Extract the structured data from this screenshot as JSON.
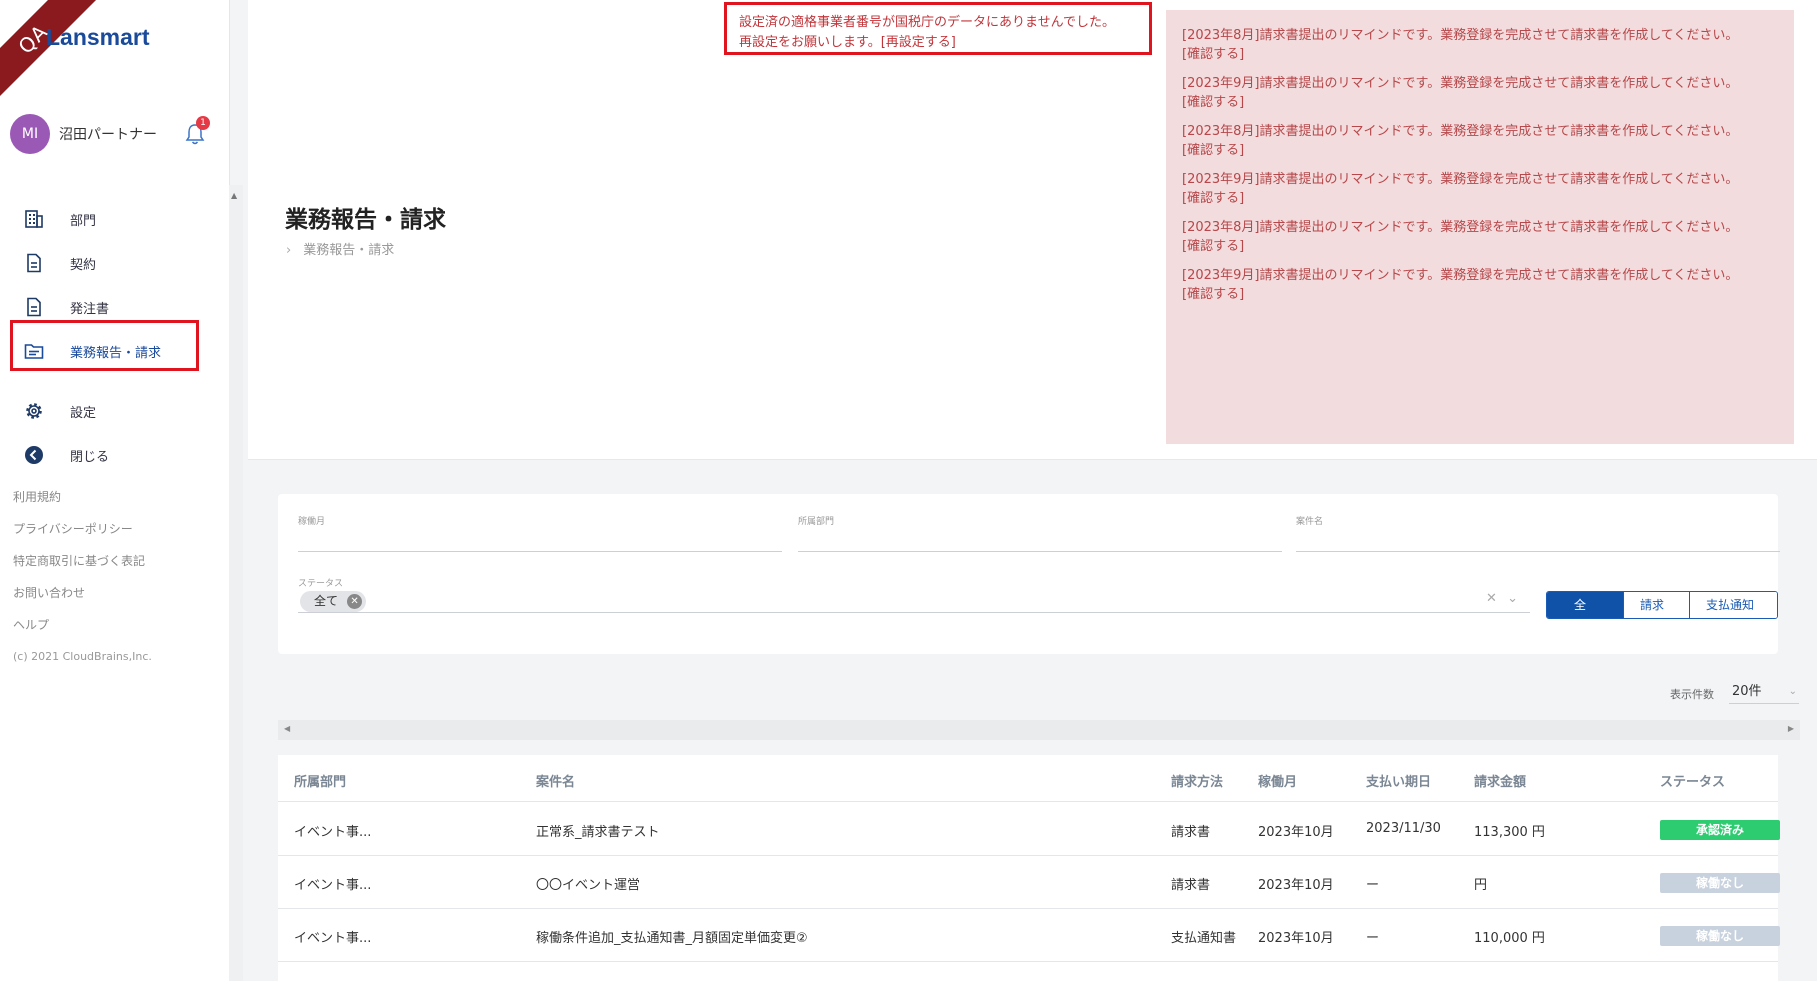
{
  "ribbon": "QA",
  "logo": "Lansmart",
  "user": {
    "initials": "MI",
    "name": "沼田パートナー",
    "notifications": "1"
  },
  "nav": {
    "items": [
      {
        "label": "部門"
      },
      {
        "label": "契約"
      },
      {
        "label": "発注書"
      },
      {
        "label": "業務報告・請求"
      },
      {
        "label": "設定"
      },
      {
        "label": "閉じる"
      }
    ],
    "links": [
      "利用規約",
      "プライバシーポリシー",
      "特定商取引に基づく表記",
      "お問い合わせ",
      "ヘルプ"
    ],
    "copyright": "(c) 2021 CloudBrains,Inc."
  },
  "page": {
    "title": "業務報告・請求",
    "breadcrumb": "業務報告・請求"
  },
  "alert": {
    "line1": "設定済の適格事業者番号が国税庁のデータにありませんでした。",
    "line2": "再設定をお願いします。[再設定する]"
  },
  "reminders": [
    {
      "text": "[2023年8月]請求書提出のリマインドです。業務登録を完成させて請求書を作成してください。",
      "action": "[確認する]"
    },
    {
      "text": "[2023年9月]請求書提出のリマインドです。業務登録を完成させて請求書を作成してください。",
      "action": "[確認する]"
    },
    {
      "text": "[2023年8月]請求書提出のリマインドです。業務登録を完成させて請求書を作成してください。",
      "action": "[確認する]"
    },
    {
      "text": "[2023年9月]請求書提出のリマインドです。業務登録を完成させて請求書を作成してください。",
      "action": "[確認する]"
    },
    {
      "text": "[2023年8月]請求書提出のリマインドです。業務登録を完成させて請求書を作成してください。",
      "action": "[確認する]"
    },
    {
      "text": "[2023年9月]請求書提出のリマインドです。業務登録を完成させて請求書を作成してください。",
      "action": "[確認する]"
    }
  ],
  "filters": {
    "month_label": "稼働月",
    "dept_label": "所属部門",
    "case_label": "案件名",
    "status_label": "ステータス",
    "status_chip": "全て",
    "segments": [
      "全て",
      "請求書",
      "支払通知書"
    ]
  },
  "count": {
    "label": "表示件数",
    "value": "20件"
  },
  "table": {
    "headers": [
      "所属部門",
      "案件名",
      "請求方法",
      "稼働月",
      "支払い期日",
      "請求金額",
      "ステータス"
    ],
    "rows": [
      {
        "dept": "イベント事...",
        "case": "正常系_請求書テスト",
        "method": "請求書",
        "month": "2023年10月",
        "due": "2023/11/30",
        "amount": "113,300 円",
        "status": "承認済み",
        "status_color": "#2ecc71"
      },
      {
        "dept": "イベント事...",
        "case": "〇〇イベント運営",
        "method": "請求書",
        "month": "2023年10月",
        "due": "ー",
        "amount": "円",
        "status": "稼働なし",
        "status_color": "#c8d2de"
      },
      {
        "dept": "イベント事...",
        "case": "稼働条件追加_支払通知書_月額固定単価変更②",
        "method": "支払通知書",
        "month": "2023年10月",
        "due": "ー",
        "amount": "110,000 円",
        "status": "稼働なし",
        "status_color": "#c8d2de"
      }
    ]
  }
}
